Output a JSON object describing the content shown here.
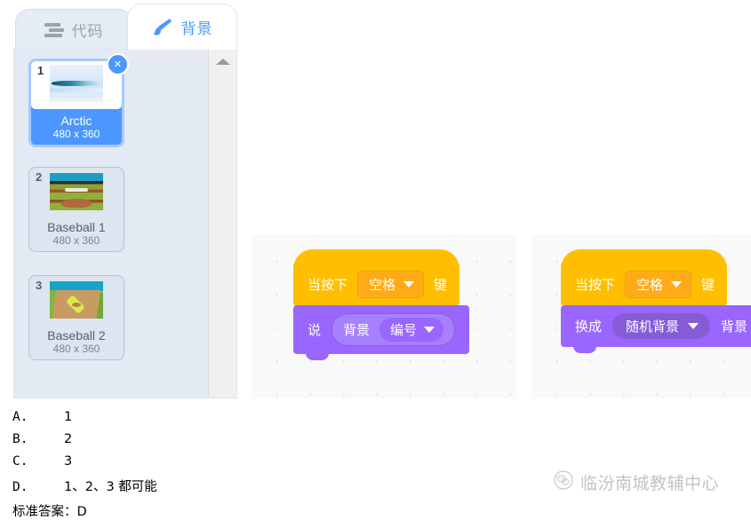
{
  "tabs": [
    {
      "label": "代码",
      "icon": "code-icon",
      "active": false
    },
    {
      "label": "背景",
      "icon": "paintbrush-icon",
      "active": true
    }
  ],
  "backdrop_list": {
    "scroll_up_icon": "chevron-up-icon",
    "close_icon": "close-icon",
    "items": [
      {
        "number": "1",
        "name": "Arctic",
        "size": "480 x 360",
        "selected": true
      },
      {
        "number": "2",
        "name": "Baseball 1",
        "size": "480 x 360",
        "selected": false
      },
      {
        "number": "3",
        "name": "Baseball 2",
        "size": "480 x 360",
        "selected": false
      }
    ]
  },
  "scripts": [
    {
      "hat": {
        "pre": "当按下",
        "dropdown": "空格",
        "post": "键"
      },
      "body": {
        "pre": "说",
        "reporter_pre": "背景",
        "reporter_dropdown": "编号",
        "post": ""
      }
    },
    {
      "hat": {
        "pre": "当按下",
        "dropdown": "空格",
        "post": "键"
      },
      "body": {
        "pre": "换成",
        "dropdown": "随机背景",
        "post": "背景"
      }
    }
  ],
  "answers": {
    "options": [
      {
        "key": "A.",
        "value": "1"
      },
      {
        "key": "B.",
        "value": "2"
      },
      {
        "key": "C.",
        "value": "3"
      },
      {
        "key": "D.",
        "value": "1、2、3 都可能"
      }
    ],
    "standard_answer": "标准答案：D"
  },
  "watermark": {
    "text": "临汾南城教辅中心",
    "icon": "wechat-logo-icon"
  },
  "colors": {
    "accent_blue": "#4c97ff",
    "events_yellow": "#ffbf00",
    "looks_purple": "#9966ff",
    "panel_bg": "#e3eaf4"
  }
}
